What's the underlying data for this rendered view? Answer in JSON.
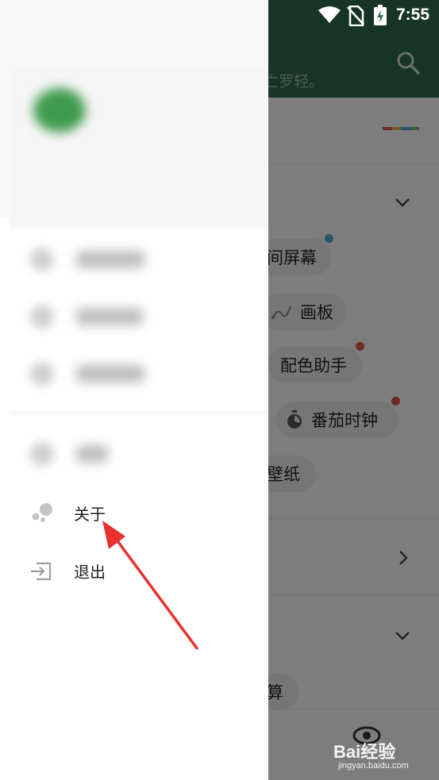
{
  "status_bar": {
    "time": "7:55"
  },
  "background": {
    "subtitle": "亡罗轻。",
    "colors": {
      "header": "#2f6b4c",
      "strip": [
        "#e2574c",
        "#f0b34a",
        "#4aa3df",
        "#6fbf73"
      ]
    },
    "chips": [
      {
        "label": "间屏幕",
        "dot_color": "#4fb3bf"
      },
      {
        "label": "画板",
        "icon": "draw-icon"
      },
      {
        "label": "配色助手",
        "dot_color": "#e2574c"
      },
      {
        "label": "番茄时钟",
        "icon": "timer-icon",
        "dot_color": "#e2574c"
      },
      {
        "label": "壁纸"
      },
      {
        "label": "算"
      }
    ]
  },
  "drawer": {
    "menu": [
      {
        "label": "关于",
        "icon": "about-dots-icon"
      },
      {
        "label": "退出",
        "icon": "exit-icon"
      }
    ]
  },
  "watermark": {
    "logo": "Bai经验",
    "sub": "jingyan.baidu.com"
  }
}
